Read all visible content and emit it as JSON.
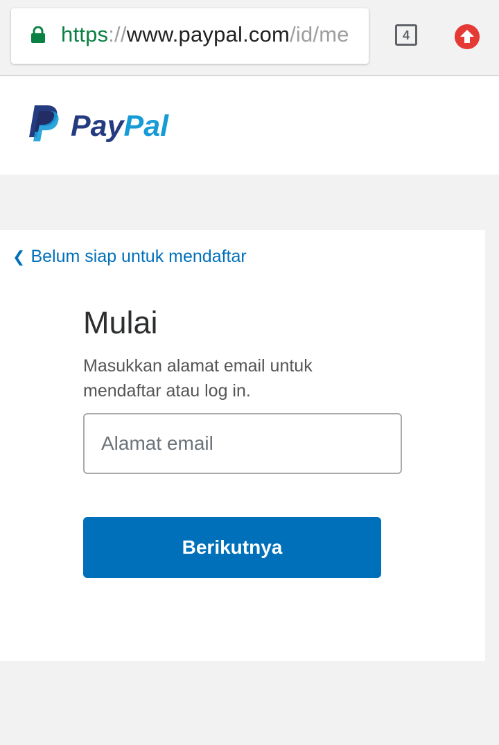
{
  "browser": {
    "url_scheme": "https",
    "url_separator": "://",
    "url_host": "www.paypal.com",
    "url_path": "/id/me",
    "tab_count": "4",
    "icons": {
      "lock": "lock-icon",
      "upload": "arrow-up-icon"
    },
    "colors": {
      "secure": "#0b8043",
      "upload": "#e53935"
    }
  },
  "header": {
    "logo_pay": "Pay",
    "logo_pal": "Pal",
    "colors": {
      "pay": "#253b80",
      "pal": "#179bd7"
    }
  },
  "signup": {
    "back_link": "Belum siap untuk mendaftar",
    "title": "Mulai",
    "subtitle": "Masukkan alamat email untuk mendaftar atau log in.",
    "email_placeholder": "Alamat email",
    "email_value": "",
    "next_button": "Berikutnya"
  },
  "colors": {
    "accent": "#0070ba",
    "background": "#f2f2f2"
  }
}
